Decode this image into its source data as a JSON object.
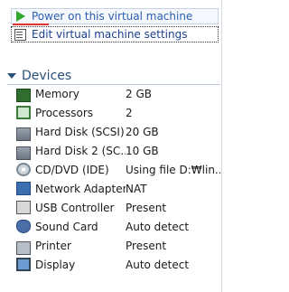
{
  "actions": {
    "power_on": "Power on this virtual machine",
    "edit_settings": "Edit virtual machine settings"
  },
  "section": {
    "title": "Devices"
  },
  "devices": [
    {
      "name": "Memory",
      "value": "2 GB",
      "icon": "memory-icon"
    },
    {
      "name": "Processors",
      "value": "2",
      "icon": "processor-icon"
    },
    {
      "name": "Hard Disk (SCSI)",
      "value": "20 GB",
      "icon": "hard-disk-icon"
    },
    {
      "name": "Hard Disk 2 (SC...",
      "value": "10 GB",
      "icon": "hard-disk-icon"
    },
    {
      "name": "CD/DVD (IDE)",
      "value": "Using file D:₩lin...",
      "icon": "cd-dvd-icon"
    },
    {
      "name": "Network Adapter",
      "value": "NAT",
      "icon": "network-adapter-icon"
    },
    {
      "name": "USB Controller",
      "value": "Present",
      "icon": "usb-icon"
    },
    {
      "name": "Sound Card",
      "value": "Auto detect",
      "icon": "sound-card-icon"
    },
    {
      "name": "Printer",
      "value": "Present",
      "icon": "printer-icon"
    },
    {
      "name": "Display",
      "value": "Auto detect",
      "icon": "display-icon"
    }
  ],
  "colors": {
    "link": "#2a5db0",
    "section_title": "#2a4f7a",
    "power_icon": "#2ea82e",
    "annotation_underline": "#e03030"
  }
}
